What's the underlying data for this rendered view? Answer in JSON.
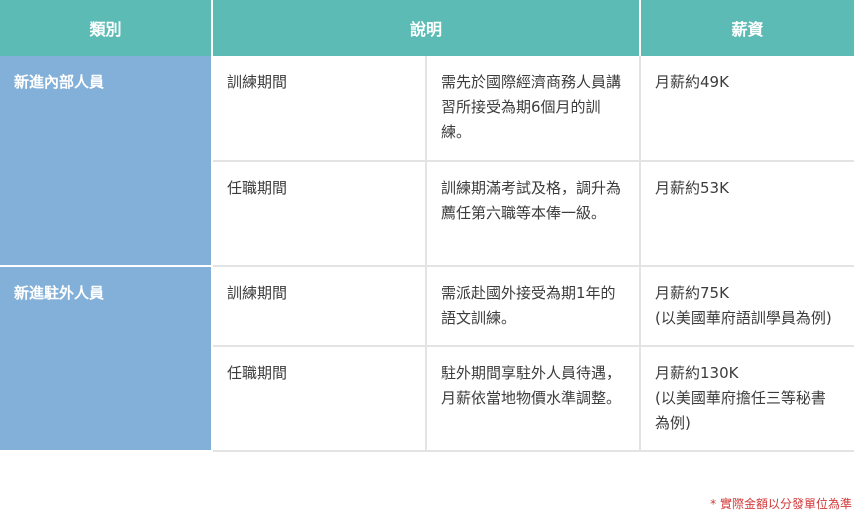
{
  "headers": {
    "category": "類別",
    "description": "說明",
    "salary": "薪資"
  },
  "groups": [
    {
      "category": "新進內部人員",
      "rows": [
        {
          "period": "訓練期間",
          "detail": "需先於國際經濟商務人員講習所接受為期6個月的訓練。",
          "salary": [
            "月薪約49K"
          ]
        },
        {
          "period": "任職期間",
          "detail": "訓練期滿考試及格，調升為薦任第六職等本俸一級。",
          "salary": [
            "月薪約53K"
          ]
        }
      ]
    },
    {
      "category": "新進駐外人員",
      "rows": [
        {
          "period": "訓練期間",
          "detail": "需派赴國外接受為期1年的語文訓練。",
          "salary": [
            "月薪約75K",
            "(以美國華府語訓學員為例)"
          ]
        },
        {
          "period": "任職期間",
          "detail": "駐外期間享駐外人員待遇，月薪依當地物價水準調整。",
          "salary": [
            "月薪約130K",
            "(以美國華府擔任三等秘書為例)"
          ]
        }
      ]
    }
  ],
  "footnote": "* 實際金額以分發單位為準"
}
